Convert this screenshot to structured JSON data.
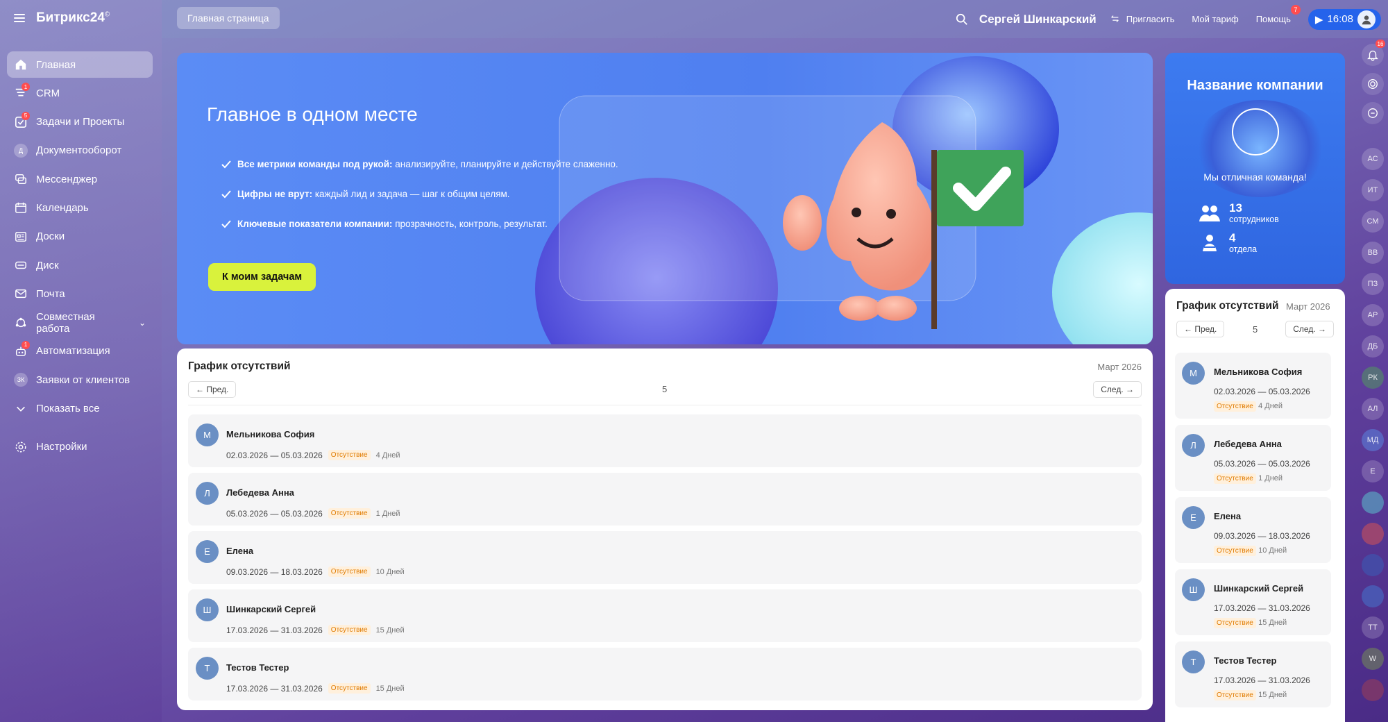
{
  "app": {
    "logo": "Битрикс24",
    "logo_sup": "©"
  },
  "sidebar": {
    "items": [
      {
        "label": "Главная",
        "icon": "home-icon",
        "active": true
      },
      {
        "label": "CRM",
        "icon": "crm-icon",
        "badge": "1"
      },
      {
        "label": "Задачи и Проекты",
        "icon": "tasks-icon",
        "badge": "5"
      },
      {
        "label": "Документооборот",
        "icon": "documents-icon",
        "letter": "Д"
      },
      {
        "label": "Мессенджер",
        "icon": "messenger-icon"
      },
      {
        "label": "Календарь",
        "icon": "calendar-icon"
      },
      {
        "label": "Доски",
        "icon": "boards-icon"
      },
      {
        "label": "Диск",
        "icon": "disk-icon"
      },
      {
        "label": "Почта",
        "icon": "mail-icon"
      },
      {
        "label": "Совместная работа",
        "icon": "collaboration-icon"
      },
      {
        "label": "Автоматизация",
        "icon": "automation-icon",
        "badge": "1"
      },
      {
        "label": "Заявки от клиентов",
        "icon": "requests-icon",
        "letter": "ЗК"
      },
      {
        "label": "Показать все",
        "icon": "chevron-down-icon"
      }
    ],
    "settings": "Настройки"
  },
  "topbar": {
    "breadcrumb": "Главная страница",
    "user_name": "Сергей Шинкарский",
    "invite": "Пригласить",
    "tariff": "Мой тариф",
    "help": "Помощь",
    "help_badge": "7",
    "time": "16:08"
  },
  "banner": {
    "title": "Главное в одном месте",
    "bullets": [
      {
        "bold": "Все метрики команды под рукой:",
        "text": " анализируйте, планируйте и действуйте слаженно."
      },
      {
        "bold": "Цифры не врут:",
        "text": " каждый лид и задача — шаг к общим целям."
      },
      {
        "bold": "Ключевые показатели компании:",
        "text": " прозрачность, контроль, результат."
      }
    ],
    "button": "К моим задачам"
  },
  "company": {
    "title": "Название компании",
    "motto": "Мы отличная команда!",
    "employees_count": "13",
    "employees_label": "сотрудников",
    "departments_count": "4",
    "departments_label": "отдела"
  },
  "absence": {
    "title": "График отсутствий",
    "month": "Март 2026",
    "prev": "← Пред.",
    "next": "След. →",
    "page": "5",
    "rows": [
      {
        "initial": "М",
        "name": "Мельникова София",
        "dates": "02.03.2026 — 05.03.2026",
        "tag": "Отсутствие",
        "days": "4 Дней"
      },
      {
        "initial": "Л",
        "name": "Лебедева Анна",
        "dates": "05.03.2026 — 05.03.2026",
        "tag": "Отсутствие",
        "days": "1 Дней"
      },
      {
        "initial": "Е",
        "name": "Елена",
        "dates": "09.03.2026 — 18.03.2026",
        "tag": "Отсутствие",
        "days": "10 Дней"
      },
      {
        "initial": "Ш",
        "name": "Шинкарский Сергей",
        "dates": "17.03.2026 — 31.03.2026",
        "tag": "Отсутствие",
        "days": "15 Дней"
      },
      {
        "initial": "Т",
        "name": "Тестов Тестер",
        "dates": "17.03.2026 — 31.03.2026",
        "tag": "Отсутствие",
        "days": "15 Дней"
      }
    ]
  },
  "rail": {
    "notifications_badge": "16",
    "avatars": [
      "АС",
      "ИТ",
      "СМ",
      "ВВ",
      "ПЗ",
      "АР",
      "ДБ",
      "РК",
      "АЛ",
      "МД",
      "Е",
      "",
      "",
      "",
      "",
      "ТТ",
      "W",
      ""
    ]
  },
  "colors": {
    "accent": "#2563eb",
    "banner_button": "#d9f23c",
    "tag_bg": "#fff0dc",
    "tag_text": "#e07b00",
    "avatar": "#6a8fc4"
  }
}
